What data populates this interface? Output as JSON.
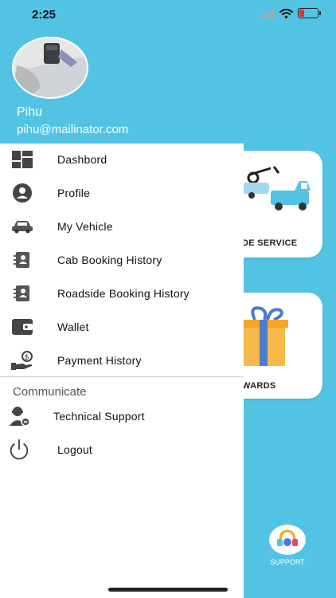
{
  "status_bar": {
    "time": "2:25"
  },
  "profile": {
    "name": "Pihu",
    "email": "pihu@mailinator.com"
  },
  "menu": {
    "items": [
      {
        "label": "Dashbord",
        "icon": "dashboard-icon"
      },
      {
        "label": "Profile",
        "icon": "person-icon"
      },
      {
        "label": "My Vehicle",
        "icon": "car-icon"
      },
      {
        "label": "Cab Booking History",
        "icon": "booking-history-icon"
      },
      {
        "label": "Roadside Booking History",
        "icon": "booking-history-icon"
      },
      {
        "label": "Wallet",
        "icon": "wallet-icon"
      },
      {
        "label": "Payment History",
        "icon": "payment-icon"
      }
    ],
    "section_title": "Communicate",
    "communicate_items": [
      {
        "label": "Technical Support",
        "icon": "technical-support-icon"
      },
      {
        "label": "Logout",
        "icon": "power-icon"
      }
    ]
  },
  "background_cards": [
    {
      "label": "DE SERVICE",
      "icon": "tow-truck-icon"
    },
    {
      "label": "WARDS",
      "icon": "gift-icon"
    }
  ],
  "support": {
    "label": "SUPPORT"
  },
  "colors": {
    "primary": "#52c3e3",
    "drawer_bg": "#ffffff",
    "icon_gray": "#444444",
    "text": "#111111",
    "gift_orange": "#f6a623",
    "gift_blue": "#4a7bd0"
  }
}
